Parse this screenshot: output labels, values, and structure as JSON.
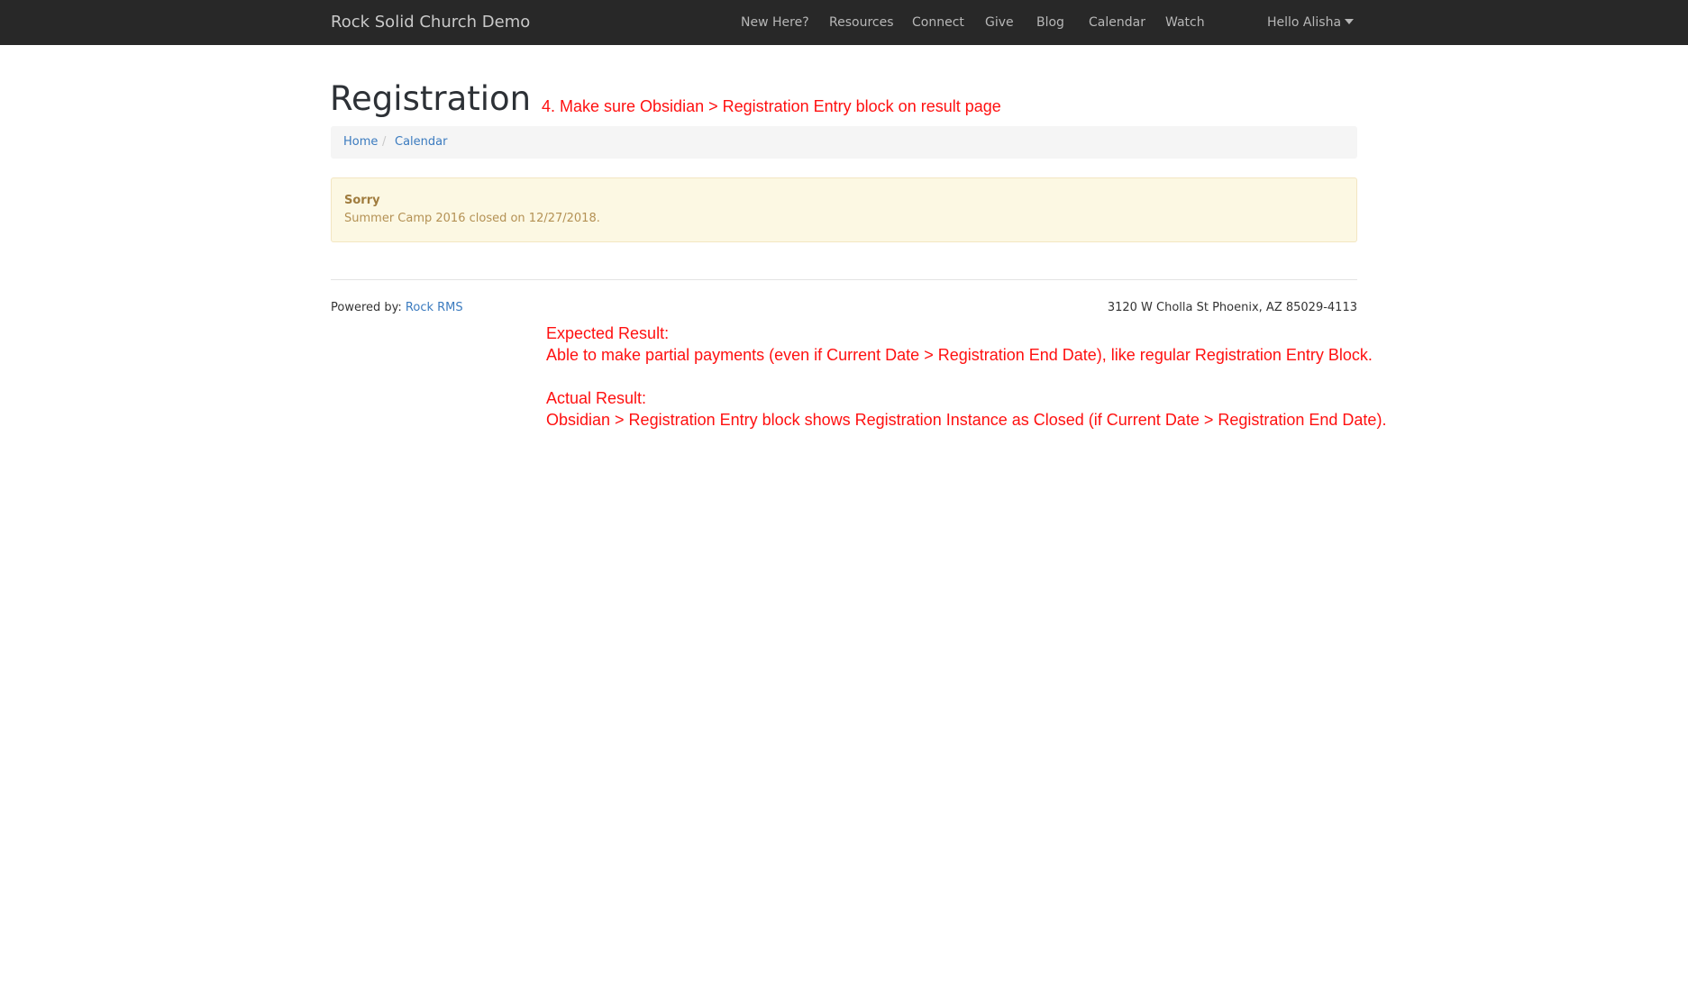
{
  "navbar": {
    "brand": "Rock Solid Church Demo",
    "items": [
      {
        "label": "New Here?"
      },
      {
        "label": "Resources"
      },
      {
        "label": "Connect"
      },
      {
        "label": "Give"
      },
      {
        "label": "Blog"
      },
      {
        "label": "Calendar"
      },
      {
        "label": "Watch"
      }
    ],
    "user_greeting": "Hello Alisha"
  },
  "page": {
    "title": "Registration"
  },
  "breadcrumb": {
    "items": [
      {
        "label": "Home"
      },
      {
        "label": "Calendar"
      }
    ],
    "separator": "/"
  },
  "alert": {
    "title": "Sorry",
    "message": "Summer Camp 2016 closed on 12/27/2018."
  },
  "footer": {
    "powered_label": "Powered by:",
    "powered_link": "Rock RMS",
    "address": "3120 W Cholla St Phoenix, AZ 85029-4113"
  },
  "annotations": {
    "step": "4. Make sure Obsidian > Registration Entry block on result page",
    "expected_label": "Expected Result:",
    "expected_text": "Able to make partial payments (even if Current Date > Registration End Date), like regular Registration Entry Block.",
    "actual_label": "Actual Result:",
    "actual_text": "Obsidian > Registration Entry block shows Registration Instance as Closed (if Current Date > Registration End Date)."
  },
  "colors": {
    "navbar_bg": "#282828",
    "link": "#3b7bbf",
    "annotation": "#ff1010",
    "alert_bg": "#fcf8e3"
  }
}
